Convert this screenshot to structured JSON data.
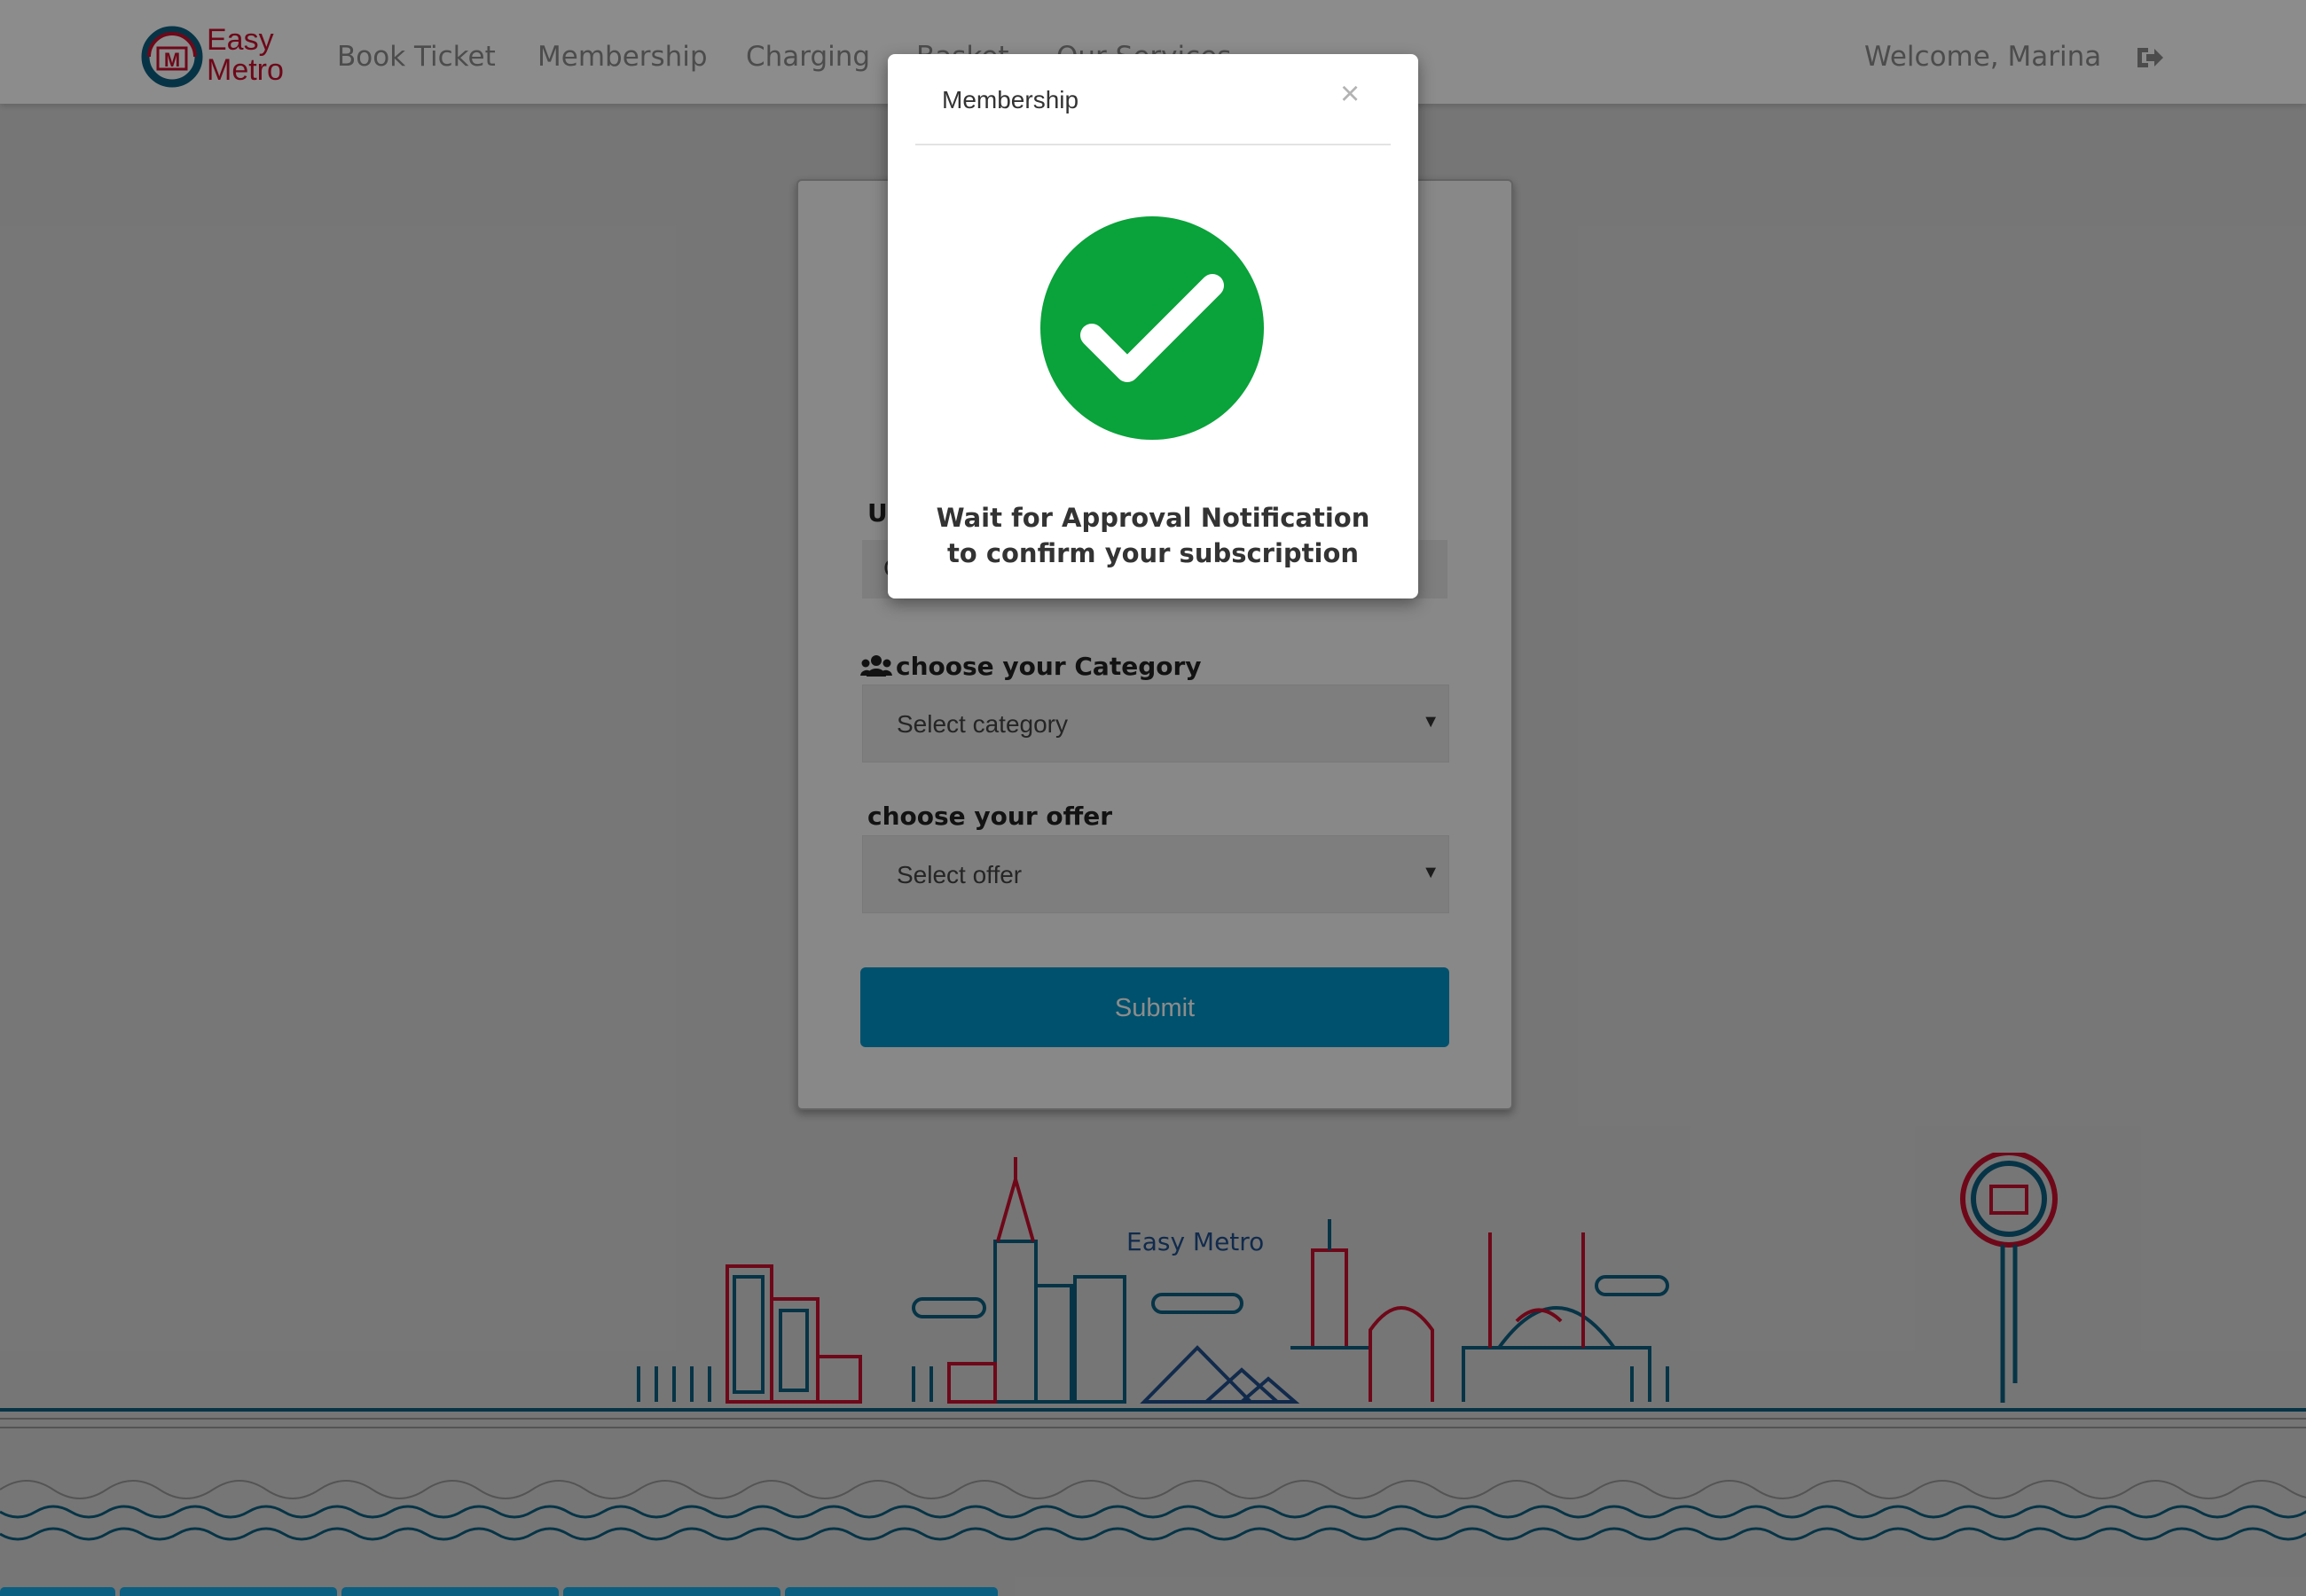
{
  "navbar": {
    "brand_line1": "Easy",
    "brand_line2": "Metro",
    "items": [
      {
        "label": "Book Ticket"
      },
      {
        "label": "Membership"
      },
      {
        "label": "Charging"
      },
      {
        "label": "Basket"
      },
      {
        "label": "Our Services"
      }
    ],
    "welcome": "Welcome, Marina",
    "logout_icon": "sign-out-icon"
  },
  "form": {
    "upload_label": "Up",
    "upload_value": "C",
    "category_label": "choose your Category",
    "category_icon": "users-icon",
    "category_select": "Select category",
    "offer_label": "choose your offer",
    "offer_select": "Select offer",
    "submit_label": "Submit"
  },
  "skyline": {
    "caption": "Easy Metro"
  },
  "modal": {
    "title": "Membership",
    "close": "×",
    "icon": "check-circle-icon",
    "message": "Wait for Approval Notification to confirm your subscription"
  },
  "colors": {
    "brand_red": "#c8102e",
    "brand_blue": "#0b5f80",
    "submit": "#0094c6",
    "success_green": "#0aa23a"
  }
}
